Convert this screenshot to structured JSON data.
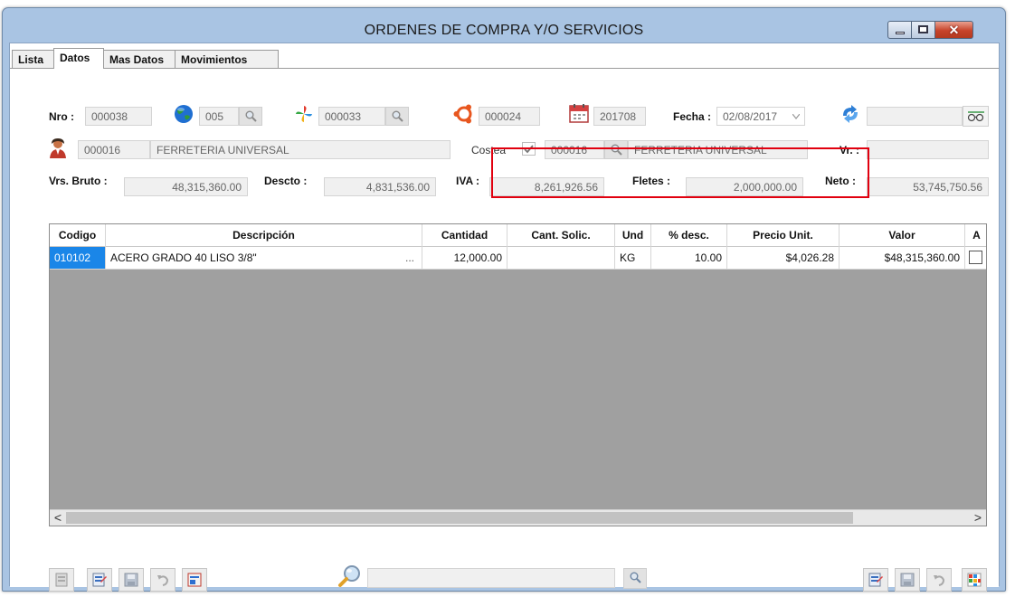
{
  "window": {
    "title": "ORDENES DE COMPRA Y/O SERVICIOS",
    "close_glyph": "✕"
  },
  "tabs": [
    {
      "label": "Lista",
      "active": false
    },
    {
      "label": "Datos",
      "active": true
    },
    {
      "label": "Mas Datos",
      "active": false
    },
    {
      "label": "Movimientos",
      "active": false
    }
  ],
  "header": {
    "nro_label": "Nro :",
    "nro_value": "000038",
    "globe_value": "005",
    "star_value": "000033",
    "wheel_value": "000024",
    "calendar_value": "201708",
    "fecha_label": "Fecha :",
    "fecha_value": "02/08/2017",
    "extra_value": "",
    "user_code": "000016",
    "user_name": "FERRETERIA UNIVERSAL",
    "costea_label": "Costea",
    "costea_checked": true,
    "costea_code": "000016",
    "costea_name": "FERRETERIA UNIVERSAL",
    "vr_label": "Vr. :",
    "vr_value": ""
  },
  "totals": {
    "bruto_label": "Vrs. Bruto :",
    "bruto_value": "48,315,360.00",
    "descto_label": "Descto :",
    "descto_value": "4,831,536.00",
    "iva_label": "IVA :",
    "iva_value": "8,261,926.56",
    "fletes_label": "Fletes :",
    "fletes_value": "2,000,000.00",
    "neto_label": "Neto :",
    "neto_value": "53,745,750.56"
  },
  "grid": {
    "columns": [
      "Codigo",
      "Descripción",
      "Cantidad",
      "Cant. Solic.",
      "Und",
      "% desc.",
      "Precio Unit.",
      "Valor",
      "A"
    ],
    "rows": [
      {
        "codigo": "010102",
        "descripcion": "ACERO GRADO 40 LISO  3/8\"",
        "ellipsis": "...",
        "cantidad": "12,000.00",
        "cant_solic": "",
        "und": "KG",
        "desc": "10.00",
        "precio": "$4,026.28",
        "valor": "$48,315,360.00",
        "a_checked": false
      }
    ],
    "scroll_left": "<",
    "scroll_right": ">"
  },
  "toolbar": {
    "search_value": ""
  },
  "colors": {
    "selection": "#1a86e8",
    "highlight_box": "#e1000f",
    "grid_background": "#a0a0a0"
  }
}
